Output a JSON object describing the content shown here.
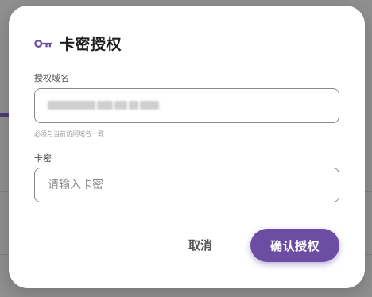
{
  "dialog": {
    "title": "卡密授权",
    "domain_label": "授权域名",
    "domain_value": "",
    "domain_helper": "必须与当前访问域名一致",
    "card_label": "卡密",
    "card_placeholder": "请输入卡密",
    "cancel_label": "取消",
    "confirm_label": "确认授权",
    "accent_color": "#6b4ea3"
  },
  "icons": {
    "title_icon": "key-icon"
  }
}
